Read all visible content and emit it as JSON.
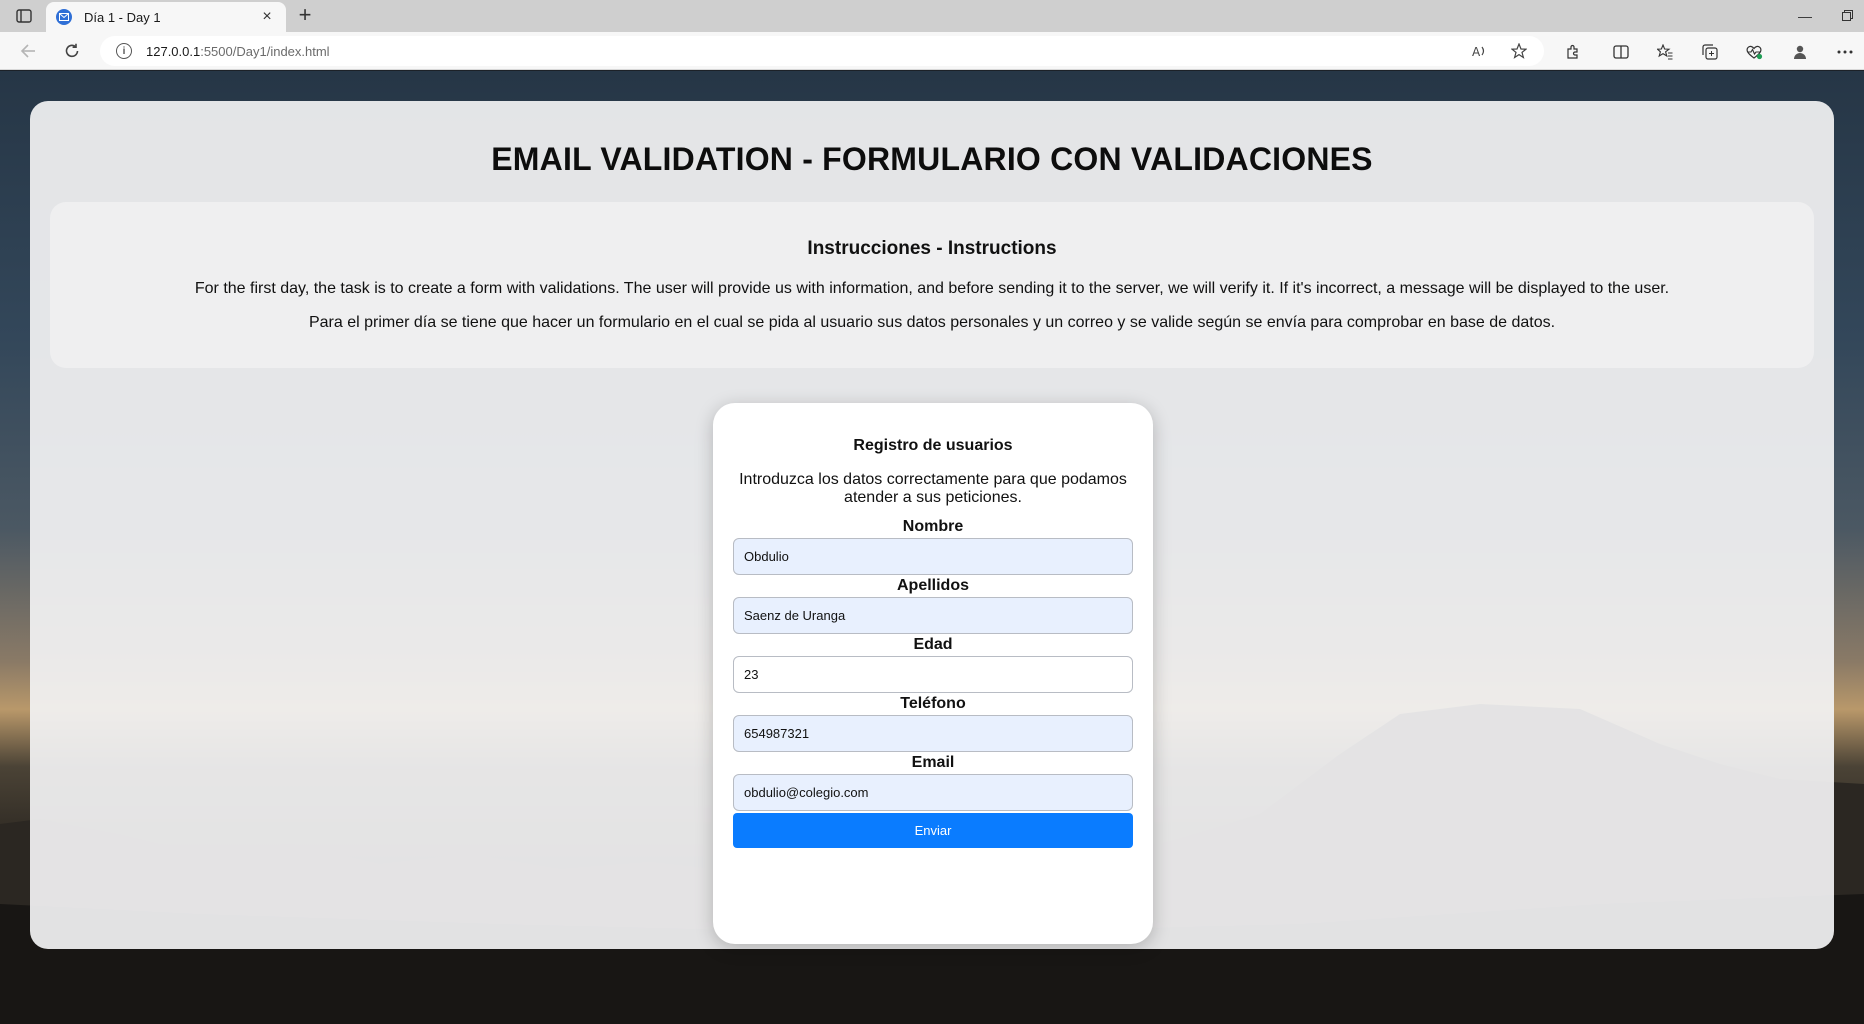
{
  "browser": {
    "tab_title": "Día 1 - Day 1",
    "tab_close": "×",
    "new_tab": "+",
    "url_host": "127.0.0.1",
    "url_path": ":5500/Day1/index.html"
  },
  "page": {
    "title": "EMAIL VALIDATION - FORMULARIO CON VALIDACIONES",
    "instructions_title": "Instrucciones - Instructions",
    "instructions_en": "For the first day, the task is to create a form with validations. The user will provide us with information, and before sending it to the server, we will verify it. If it's incorrect, a message will be displayed to the user.",
    "instructions_es": "Para el primer día se tiene que hacer un formulario en el cual se pida al usuario sus datos personales y un correo y se valide según se envía para comprobar en base de datos."
  },
  "form": {
    "title": "Registro de usuarios",
    "description": "Introduzca los datos correctamente para que podamos atender a sus peticiones.",
    "fields": [
      {
        "label": "Nombre",
        "value": "Obdulio"
      },
      {
        "label": "Apellidos",
        "value": "Saenz de Uranga"
      },
      {
        "label": "Edad",
        "value": "23"
      },
      {
        "label": "Teléfono",
        "value": "654987321"
      },
      {
        "label": "Email",
        "value": "obdulio@colegio.com"
      }
    ],
    "submit_label": "Enviar"
  },
  "colors": {
    "accent": "#0a7cff",
    "autofill": "#e8f0fe"
  }
}
